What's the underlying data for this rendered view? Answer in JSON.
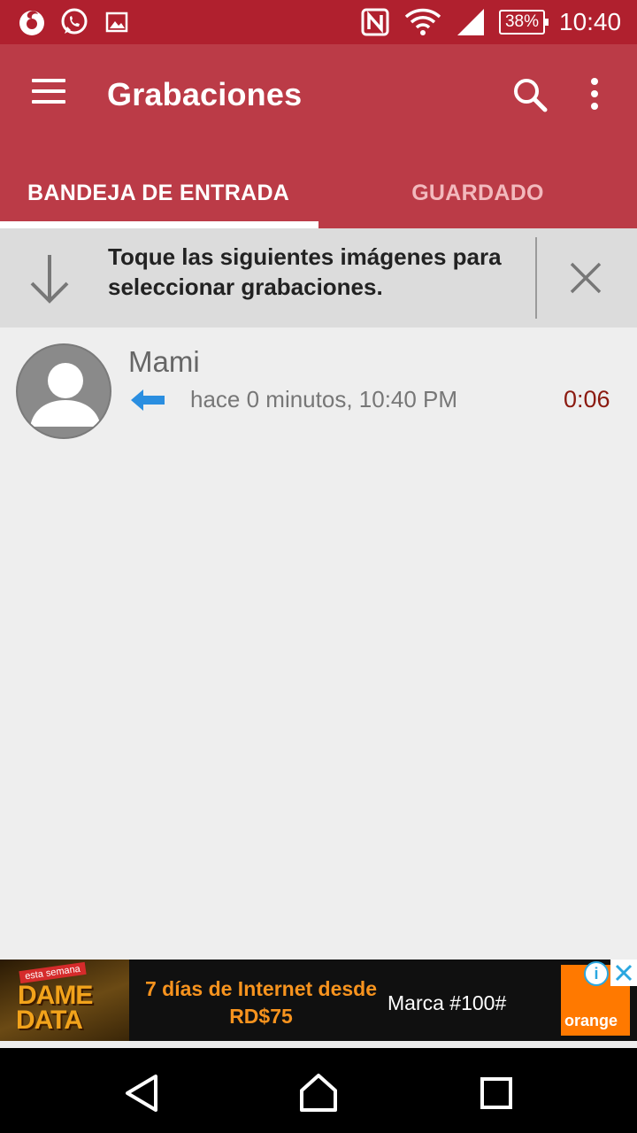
{
  "status_bar": {
    "battery": "38%",
    "time": "10:40",
    "icons": [
      "firefox-icon",
      "whatsapp-icon",
      "gallery-icon",
      "nfc-icon",
      "wifi-icon",
      "signal-icon",
      "battery-icon"
    ]
  },
  "app_bar": {
    "title": "Grabaciones",
    "icons": [
      "menu-icon",
      "search-icon",
      "more-vert-icon"
    ]
  },
  "tabs": [
    {
      "label": "BANDEJA DE ENTRADA",
      "selected": true
    },
    {
      "label": "GUARDADO",
      "selected": false
    }
  ],
  "hint": {
    "text": "Toque las siguientes imágenes para seleccionar grabaciones."
  },
  "recordings": [
    {
      "name": "Mami",
      "time": "hace 0 minutos, 10:40 PM",
      "duration": "0:06",
      "direction": "incoming"
    }
  ],
  "ad": {
    "promo_small": "esta semana",
    "promo_line1": "DAME",
    "promo_line2": "DATA",
    "headline": "7 días de Internet desde RD$75",
    "tagline": "Marca #100#",
    "brand": "orange"
  },
  "colors": {
    "status_bar": "#b0202e",
    "app_bar": "#bb3b47",
    "duration": "#8b1a10",
    "incoming_arrow": "#2a8ee0"
  }
}
